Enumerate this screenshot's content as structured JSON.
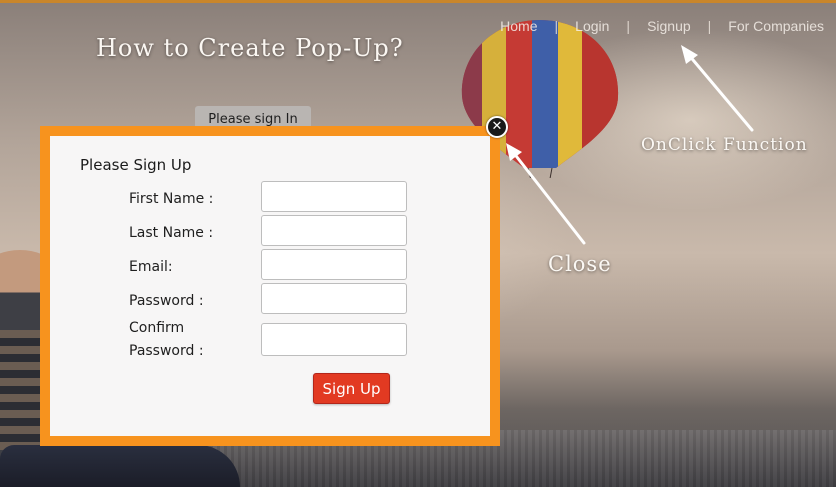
{
  "nav": {
    "items": [
      {
        "label": "Home"
      },
      {
        "label": "Login"
      },
      {
        "label": "Signup"
      },
      {
        "label": "For Companies"
      }
    ],
    "separator": "|"
  },
  "page_title": "How to Create Pop-Up?",
  "signin_button": "Please sign In",
  "annotations": {
    "onclick": "OnClick Function",
    "close": "Close"
  },
  "popup": {
    "heading": "Please Sign Up",
    "fields": [
      {
        "label": "First Name :",
        "value": ""
      },
      {
        "label": "Last Name :",
        "value": ""
      },
      {
        "label": "Email:",
        "value": ""
      },
      {
        "label": "Password :",
        "value": ""
      },
      {
        "label": "Confirm Password :",
        "value": ""
      }
    ],
    "submit_label": "Sign Up",
    "close_glyph": "✕"
  },
  "colors": {
    "popup_border": "#f7931e",
    "signup_button": "#e23a22"
  },
  "icons": {
    "close": "close-icon"
  }
}
